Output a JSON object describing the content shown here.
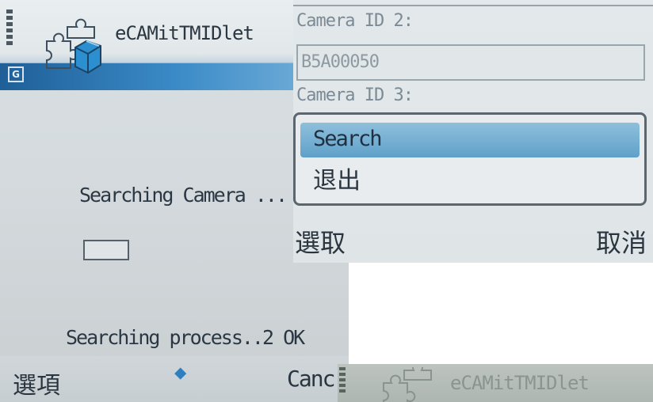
{
  "left_screen": {
    "app_title": "eCAMitTMIDlet",
    "network_badge": "G",
    "status_text": "Searching Camera ...",
    "progress_value": 0.0,
    "process_text": "Searching process..2 OK",
    "softkeys": {
      "left": "選項",
      "middle": "⬥",
      "right": "Canc"
    }
  },
  "right_screen": {
    "camera_id_2_label": "Camera ID 2:",
    "camera_id_2_value": "B5A00050",
    "camera_id_3_label": "Camera ID 3:",
    "menu": {
      "items": [
        {
          "label": "Search",
          "selected": true
        },
        {
          "label": "退出",
          "selected": false
        }
      ]
    },
    "softkeys": {
      "left": "選取",
      "right": "取消"
    }
  },
  "bottom_strip": {
    "app_title": "eCAMitTMIDlet"
  },
  "colors": {
    "selection_blue": "#5fa0c9",
    "header_blue": "#2d73ad",
    "accent_arrow": "#2e7fc0"
  }
}
